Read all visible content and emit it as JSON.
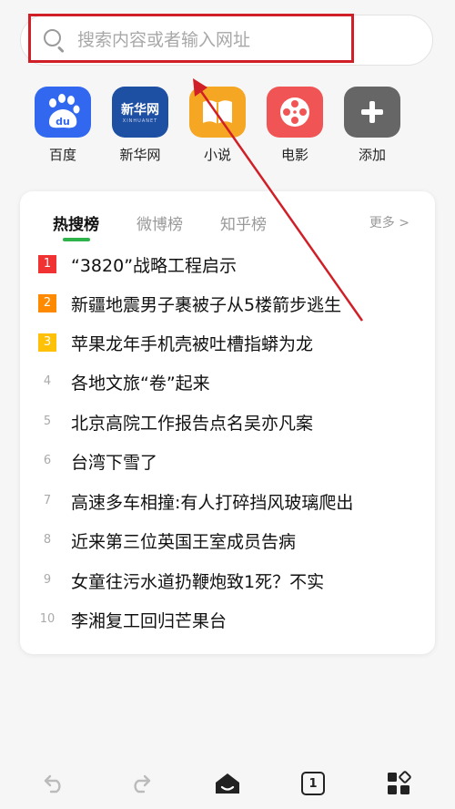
{
  "search": {
    "placeholder": "搜索内容或者输入网址"
  },
  "shortcuts": [
    {
      "label": "百度",
      "icon": "baidu-icon",
      "color": "#3268f0"
    },
    {
      "label": "新华网",
      "icon": "xinhuanet-icon",
      "color": "#1d4fa3",
      "tile_text": "新华网",
      "tile_subtext": "XINHUANET"
    },
    {
      "label": "小说",
      "icon": "book-icon",
      "color": "#f5a623"
    },
    {
      "label": "电影",
      "icon": "film-reel-icon",
      "color": "#f05454"
    },
    {
      "label": "添加",
      "icon": "plus-icon",
      "color": "#666666"
    }
  ],
  "hot": {
    "tabs": [
      "热搜榜",
      "微博榜",
      "知乎榜"
    ],
    "active_tab": "热搜榜",
    "more": "更多 >",
    "items": [
      {
        "rank": "1",
        "text": "“3820”战略工程启示",
        "badge_color": "#f03232"
      },
      {
        "rank": "2",
        "text": "新疆地震男子裹被子从5楼箭步逃生",
        "badge_color": "#ff8a00"
      },
      {
        "rank": "3",
        "text": "苹果龙年手机壳被吐槽指蟒为龙",
        "badge_color": "#ffc107"
      },
      {
        "rank": "4",
        "text": "各地文旅“卷”起来"
      },
      {
        "rank": "5",
        "text": "北京高院工作报告点名吴亦凡案"
      },
      {
        "rank": "6",
        "text": "台湾下雪了"
      },
      {
        "rank": "7",
        "text": "高速多车相撞:有人打碎挡风玻璃爬出"
      },
      {
        "rank": "8",
        "text": "近来第三位英国王室成员告病"
      },
      {
        "rank": "9",
        "text": "女童往污水道扔鞭炮致1死？不实"
      },
      {
        "rank": "10",
        "text": "李湘复工回归芒果台"
      }
    ]
  },
  "toolbar": {
    "tab_count": "1",
    "buttons": [
      "back-icon",
      "forward-icon",
      "home-icon",
      "tabs-icon",
      "menu-grid-icon"
    ]
  },
  "annotation": {
    "highlight_color": "#d01f26"
  }
}
